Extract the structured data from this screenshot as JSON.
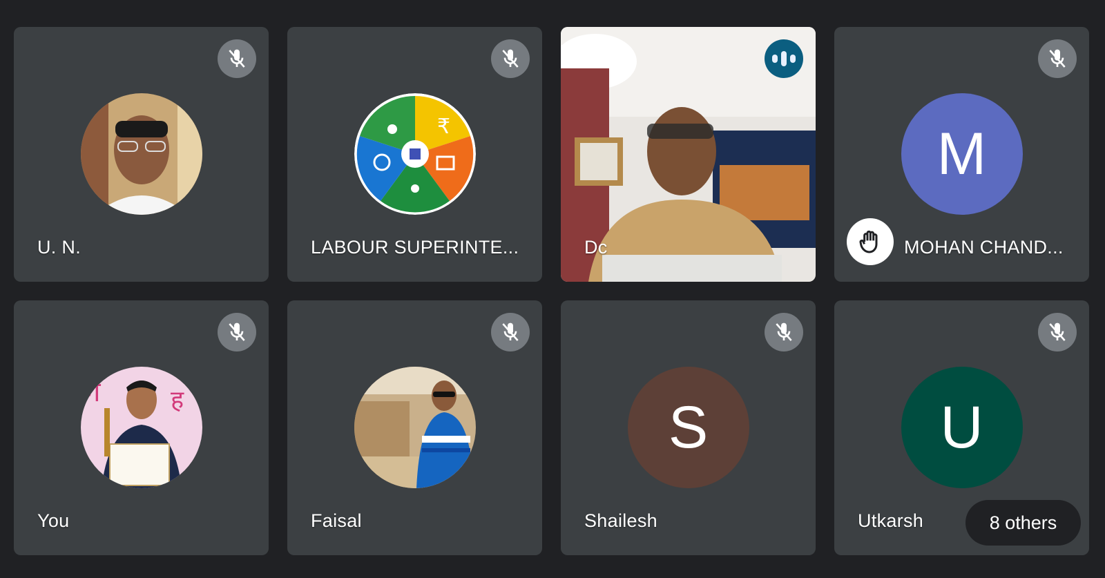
{
  "participants": [
    {
      "name": "U. N.",
      "type": "photo",
      "photo": "older-man-glasses",
      "muted": true
    },
    {
      "name": "LABOUR SUPERINTE...",
      "type": "photo",
      "photo": "labour-logo-wheel",
      "muted": true
    },
    {
      "name": "Dc",
      "type": "video",
      "speaking": true
    },
    {
      "name": "MOHAN CHAND...",
      "type": "letter",
      "letter": "M",
      "color": "#5c6bc0",
      "muted": true,
      "hand_raised": true
    },
    {
      "name": "You",
      "type": "photo",
      "photo": "man-with-certificate",
      "muted": true
    },
    {
      "name": "Faisal",
      "type": "photo",
      "photo": "man-sunglasses-outdoor",
      "muted": true
    },
    {
      "name": "Shailesh",
      "type": "letter",
      "letter": "S",
      "color": "#5d4037",
      "muted": true
    },
    {
      "name": "Utkarsh",
      "type": "letter",
      "letter": "U",
      "color": "#004d40",
      "muted": true
    }
  ],
  "others": {
    "label": "8 others"
  },
  "icons": {
    "mute": "mic-off-icon",
    "speaking": "audio-level-icon",
    "hand": "raised-hand-icon"
  },
  "colors": {
    "background": "#202124",
    "tile": "#3c4043",
    "mute_badge": "#80868b",
    "speaking_badge": "#0b5e80"
  }
}
